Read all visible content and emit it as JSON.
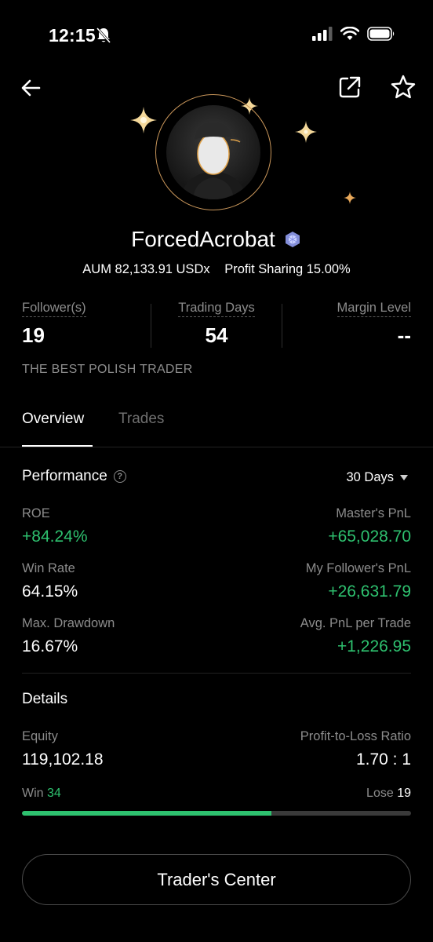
{
  "status_bar": {
    "time": "12:15",
    "icons": [
      "bell-off-icon",
      "cellular-signal-icon",
      "wifi-icon",
      "battery-icon"
    ]
  },
  "nav": {
    "icons": [
      "back-arrow-icon",
      "share-icon",
      "star-icon"
    ]
  },
  "profile": {
    "name": "ForcedAcrobat",
    "badge_icon": "diamond-badge-icon",
    "aum": "AUM 82,133.91 USDx",
    "profit_sharing": "Profit Sharing 15.00%",
    "tagline": "THE BEST POLISH TRADER",
    "accent_color": "#c9965a"
  },
  "stats": [
    {
      "label": "Follower(s)",
      "value": "19"
    },
    {
      "label": "Trading Days",
      "value": "54"
    },
    {
      "label": "Margin Level",
      "value": "--"
    }
  ],
  "tabs": [
    {
      "label": "Overview",
      "active": true
    },
    {
      "label": "Trades",
      "active": false
    }
  ],
  "performance": {
    "title": "Performance",
    "range": "30 Days",
    "metrics": [
      {
        "label": "ROE",
        "value": "+84.24%",
        "color": "#2ec16f"
      },
      {
        "label": "Master's PnL",
        "value": "+65,028.70",
        "color": "#2ec16f"
      },
      {
        "label": "Win Rate",
        "value": "64.15%",
        "color": "#ffffff"
      },
      {
        "label": "My Follower's PnL",
        "value": "+26,631.79",
        "color": "#2ec16f"
      },
      {
        "label": "Max. Drawdown",
        "value": "16.67%",
        "color": "#ffffff"
      },
      {
        "label": "Avg. PnL per Trade",
        "value": "+1,226.95",
        "color": "#2ec16f"
      }
    ]
  },
  "details": {
    "title": "Details",
    "equity_label": "Equity",
    "equity_value": "119,102.18",
    "pl_ratio_label": "Profit-to-Loss Ratio",
    "pl_ratio_value": "1.70 : 1",
    "win_label": "Win",
    "win_count": "34",
    "lose_label": "Lose",
    "lose_count": "19",
    "win_fraction": 0.6415
  },
  "cta": {
    "label": "Trader's Center"
  },
  "colors": {
    "positive": "#2ec16f",
    "muted": "#8c8c8c",
    "background": "#000000"
  }
}
